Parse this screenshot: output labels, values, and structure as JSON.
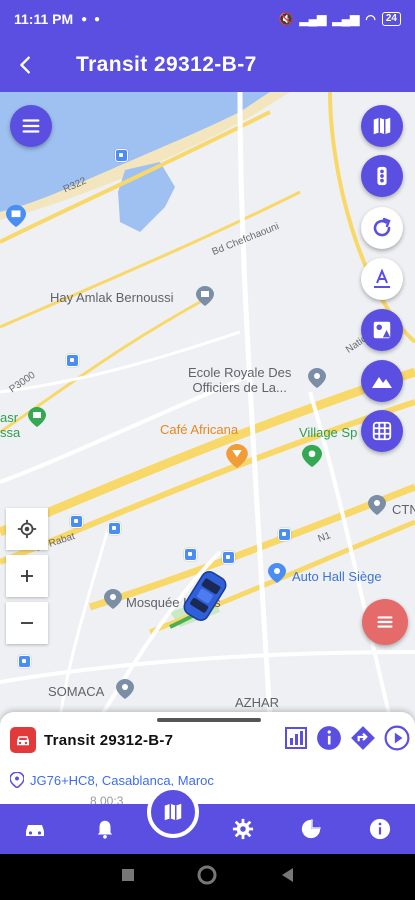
{
  "status": {
    "time": "11:11 PM",
    "battery": "24"
  },
  "appbar": {
    "title": "Transit 29312-B-7"
  },
  "map": {
    "pois": {
      "hay_amlak": "Hay Amlak Bernoussi",
      "ecole_royale": "Ecole Royale Des\nOfficiers de La...",
      "cafe": "Café Africana",
      "village": "Village Sp",
      "ctn": "CTN",
      "auto_hall": "Auto Hall Siège",
      "mosquee": "Mosquée Hoods",
      "somaca": "SOMACA",
      "azhar": "AZHAR",
      "asr": "asr\nssa"
    },
    "roads": {
      "r322": "R322",
      "bd_chef": "Bd Chefchaouni",
      "p3000": "P3000",
      "rabat": "de Rabat",
      "natio": "Natio",
      "n": "N1"
    }
  },
  "panel": {
    "vehicle_name": "Transit 29312-B-7",
    "address": "JG76+HC8, Casablanca, Maroc",
    "time": "8 00:3"
  },
  "colors": {
    "accent": "#5a4fe0",
    "vehicle_red": "#e23a3a",
    "link_blue": "#3d6cf0"
  }
}
